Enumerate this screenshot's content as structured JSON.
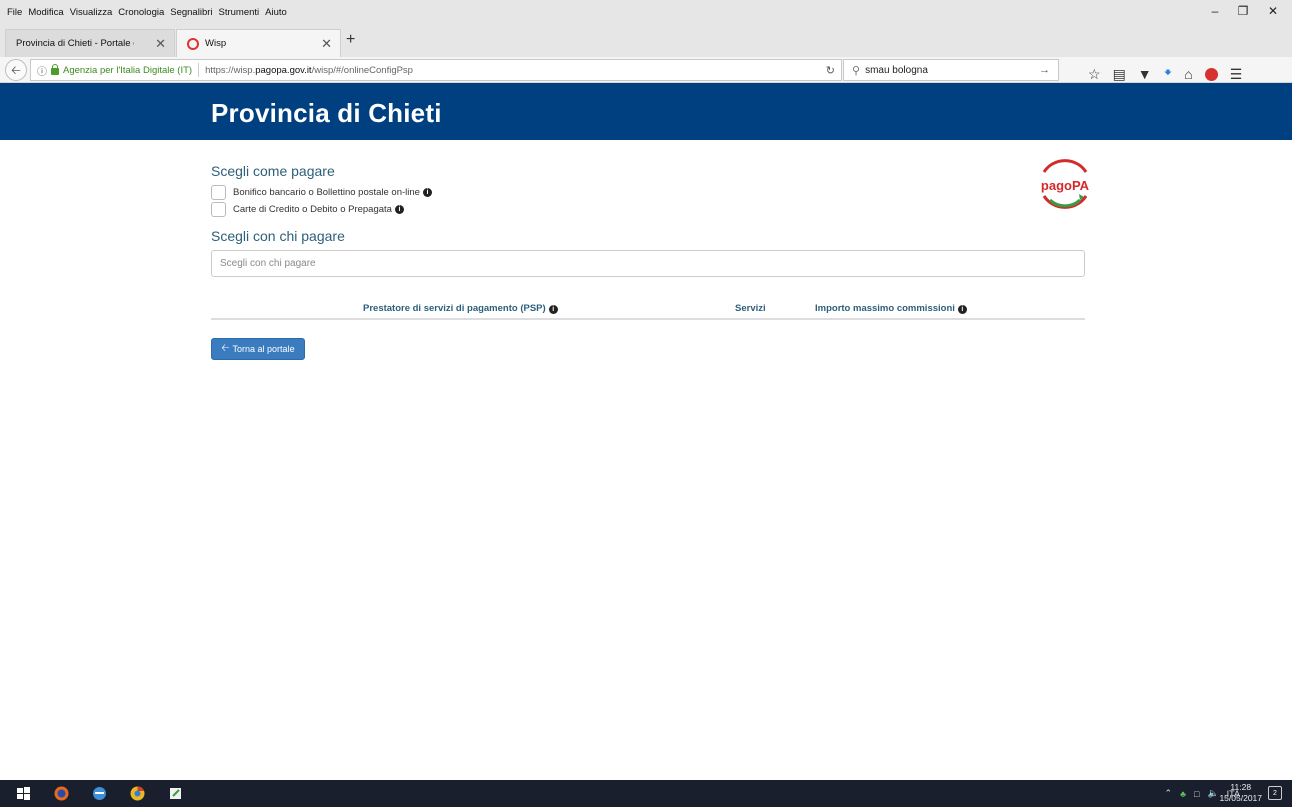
{
  "menu": [
    "File",
    "Modifica",
    "Visualizza",
    "Cronologia",
    "Segnalibri",
    "Strumenti",
    "Aiuto"
  ],
  "tabs": [
    {
      "label": "Provincia di Chieti - Portale dei s"
    },
    {
      "label": "Wisp"
    }
  ],
  "address": {
    "identity": "Agenzia per l'Italia Digitale (IT)",
    "url_prefix": "https://wisp.",
    "url_domain": "pagopa.gov.it",
    "url_path": "/wisp/#/onlineConfigPsp"
  },
  "search": {
    "value": "smau bologna"
  },
  "page": {
    "header_title": "Provincia di Chieti",
    "choose_how_title": "Scegli come pagare",
    "options": [
      {
        "label": "Bonifico bancario o Bollettino postale on-line"
      },
      {
        "label": "Carte di Credito o Debito o Prepagata"
      }
    ],
    "choose_who_title": "Scegli con chi pagare",
    "psp_placeholder": "Scegli con chi pagare",
    "table_headers": {
      "psp": "Prestatore di servizi di pagamento (PSP)",
      "services": "Servizi",
      "max_fee": "Importo massimo commissioni"
    },
    "back_button": "Torna al portale",
    "logo_text": "pagoPA"
  },
  "taskbar": {
    "lang": "ITA",
    "time": "11:28",
    "date": "15/05/2017",
    "notifications": "2"
  },
  "colors": {
    "header_bg": "#004080",
    "accent_text": "#2d5f7a",
    "button_bg": "#3a7cbf",
    "pagopa_red": "#d42a2a",
    "pagopa_green": "#3a9b45"
  }
}
